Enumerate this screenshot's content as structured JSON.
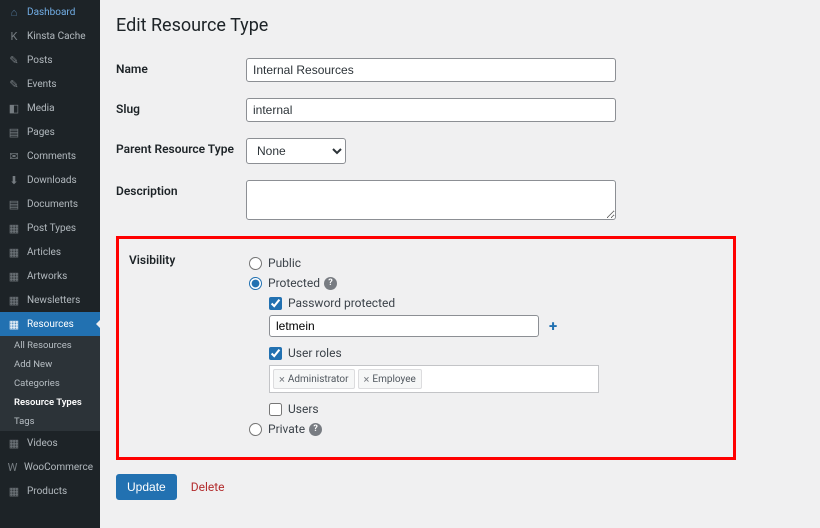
{
  "sidebar": {
    "items": [
      {
        "label": "Dashboard",
        "icon": "⌂"
      },
      {
        "label": "Kinsta Cache",
        "icon": "K"
      },
      {
        "label": "Posts",
        "icon": "✎"
      },
      {
        "label": "Events",
        "icon": "✎"
      },
      {
        "label": "Media",
        "icon": "◧"
      },
      {
        "label": "Pages",
        "icon": "▤"
      },
      {
        "label": "Comments",
        "icon": "✉"
      },
      {
        "label": "Downloads",
        "icon": "⬇"
      },
      {
        "label": "Documents",
        "icon": "▤"
      },
      {
        "label": "Post Types",
        "icon": "▦"
      },
      {
        "label": "Articles",
        "icon": "▦"
      },
      {
        "label": "Artworks",
        "icon": "▦"
      },
      {
        "label": "Newsletters",
        "icon": "▦"
      },
      {
        "label": "Resources",
        "icon": "▦"
      },
      {
        "label": "Videos",
        "icon": "▦"
      },
      {
        "label": "WooCommerce",
        "icon": "W"
      },
      {
        "label": "Products",
        "icon": "▦"
      }
    ],
    "subitems": [
      "All Resources",
      "Add New",
      "Categories",
      "Resource Types",
      "Tags"
    ]
  },
  "page": {
    "title": "Edit Resource Type"
  },
  "form": {
    "name_label": "Name",
    "name_value": "Internal Resources",
    "slug_label": "Slug",
    "slug_value": "internal",
    "parent_label": "Parent Resource Type",
    "parent_value": "None",
    "description_label": "Description",
    "description_value": ""
  },
  "visibility": {
    "label": "Visibility",
    "public_label": "Public",
    "protected_label": "Protected",
    "private_label": "Private",
    "selected": "protected",
    "password_protected_label": "Password protected",
    "password_protected_checked": true,
    "password_value": "letmein",
    "user_roles_label": "User roles",
    "user_roles_checked": true,
    "roles": [
      "Administrator",
      "Employee"
    ],
    "users_label": "Users",
    "users_checked": false
  },
  "actions": {
    "update_label": "Update",
    "delete_label": "Delete"
  }
}
